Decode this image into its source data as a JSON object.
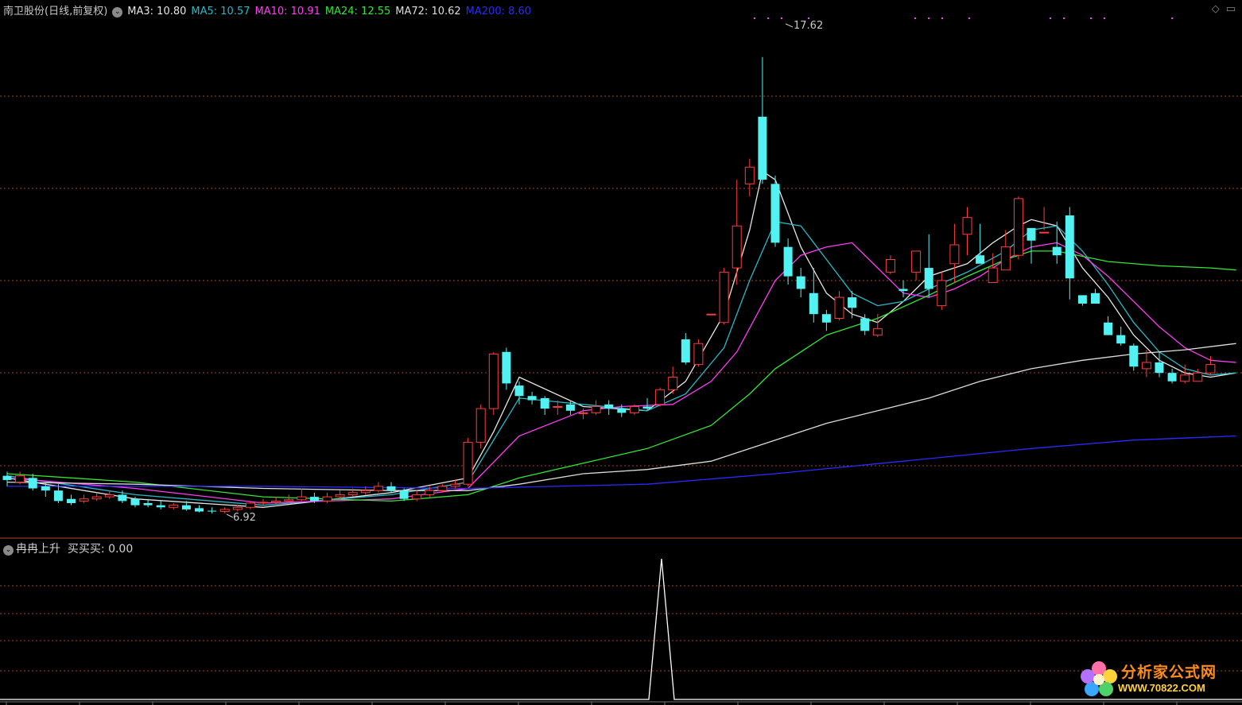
{
  "header": {
    "stock_title": "南卫股份(日线,前复权)",
    "ma_labels": [
      {
        "text": "MA3: 10.80",
        "color": "#e6e6e6"
      },
      {
        "text": "MA5: 10.57",
        "color": "#2ab7c6"
      },
      {
        "text": "MA10: 10.91",
        "color": "#ff3df5"
      },
      {
        "text": "MA24: 12.55",
        "color": "#33e633"
      },
      {
        "text": "MA72: 10.62",
        "color": "#dcdcdc"
      },
      {
        "text": "MA200: 8.60",
        "color": "#2a2aff"
      }
    ]
  },
  "annotations": {
    "high_label": "17.62",
    "low_label": "6.92"
  },
  "indicator": {
    "title": "冉冉上升",
    "value_label": "买买买: 0.00"
  },
  "watermark": {
    "line1": "分析家公式网",
    "line2": "WWW.70822.COM"
  },
  "icons": {
    "toggle": "chevron-circle-icon",
    "diamond": "diamond-icon",
    "minimize": "minimize-icon"
  },
  "colors": {
    "up": "#ff3c3c",
    "down": "#52f2f2",
    "grid": "#a2431c",
    "ma3": "#e6e6e6",
    "ma5": "#2ab7c6",
    "ma10": "#ff3df5",
    "ma24": "#33e633",
    "ma72": "#dcdcdc",
    "ma200": "#2a2aff",
    "indicator": "#ffffff"
  },
  "chart_data": {
    "type": "candlestick",
    "price_range": [
      6.3,
      18.6
    ],
    "high": 17.62,
    "low": 6.92,
    "candles": [
      [
        7.65,
        7.55,
        7.75,
        7.4
      ],
      [
        7.5,
        7.65,
        7.75,
        7.45
      ],
      [
        7.6,
        7.35,
        7.7,
        7.3
      ],
      [
        7.4,
        7.3,
        7.5,
        7.15
      ],
      [
        7.3,
        7.05,
        7.45,
        7.0
      ],
      [
        7.1,
        7.0,
        7.2,
        6.95
      ],
      [
        7.05,
        7.1,
        7.2,
        7.0
      ],
      [
        7.1,
        7.15,
        7.25,
        7.05
      ],
      [
        7.15,
        7.2,
        7.3,
        7.1
      ],
      [
        7.2,
        7.05,
        7.3,
        7.0
      ],
      [
        7.1,
        6.95,
        7.15,
        6.9
      ],
      [
        7.0,
        6.95,
        7.1,
        6.9
      ],
      [
        6.95,
        6.9,
        7.05,
        6.85
      ],
      [
        6.9,
        6.95,
        7.0,
        6.85
      ],
      [
        6.95,
        6.85,
        7.05,
        6.82
      ],
      [
        6.88,
        6.8,
        6.95,
        6.78
      ],
      [
        6.82,
        6.8,
        6.9,
        6.75
      ],
      [
        6.8,
        6.85,
        6.9,
        6.75
      ],
      [
        6.85,
        6.9,
        6.95,
        6.8
      ],
      [
        6.9,
        7.0,
        7.05,
        6.85
      ],
      [
        7.0,
        7.02,
        7.1,
        6.95
      ],
      [
        7.02,
        7.05,
        7.15,
        6.98
      ],
      [
        7.05,
        7.08,
        7.2,
        7.0
      ],
      [
        7.08,
        7.15,
        7.35,
        7.05
      ],
      [
        7.15,
        7.05,
        7.25,
        7.0
      ],
      [
        7.05,
        7.15,
        7.25,
        7.0
      ],
      [
        7.15,
        7.2,
        7.3,
        7.1
      ],
      [
        7.2,
        7.25,
        7.35,
        7.15
      ],
      [
        7.25,
        7.3,
        7.4,
        7.2
      ],
      [
        7.3,
        7.4,
        7.5,
        7.25
      ],
      [
        7.4,
        7.3,
        7.5,
        7.25
      ],
      [
        7.3,
        7.1,
        7.35,
        7.05
      ],
      [
        7.1,
        7.2,
        7.3,
        7.05
      ],
      [
        7.2,
        7.3,
        7.4,
        7.15
      ],
      [
        7.3,
        7.4,
        7.45,
        7.25
      ],
      [
        7.4,
        7.45,
        7.55,
        7.35
      ],
      [
        7.45,
        8.45,
        8.55,
        7.4
      ],
      [
        8.45,
        9.25,
        9.35,
        8.3
      ],
      [
        9.25,
        10.55,
        10.6,
        9.1
      ],
      [
        10.6,
        9.85,
        10.7,
        9.7
      ],
      [
        9.8,
        9.55,
        9.9,
        9.35
      ],
      [
        9.55,
        9.45,
        9.65,
        9.35
      ],
      [
        9.5,
        9.25,
        9.55,
        9.1
      ],
      [
        9.3,
        9.3,
        9.45,
        9.1
      ],
      [
        9.35,
        9.2,
        9.45,
        9.1
      ],
      [
        9.15,
        9.15,
        9.25,
        9.0
      ],
      [
        9.15,
        9.3,
        9.45,
        9.1
      ],
      [
        9.35,
        9.25,
        9.45,
        9.1
      ],
      [
        9.25,
        9.15,
        9.35,
        9.05
      ],
      [
        9.15,
        9.3,
        9.35,
        9.1
      ],
      [
        9.3,
        9.25,
        9.5,
        9.2
      ],
      [
        9.35,
        9.7,
        9.75,
        9.3
      ],
      [
        9.7,
        10.0,
        10.25,
        9.6
      ],
      [
        10.9,
        10.35,
        11.05,
        10.3
      ],
      [
        10.3,
        10.8,
        10.9,
        10.25
      ],
      [
        11.5,
        11.5,
        11.5,
        11.5
      ],
      [
        11.3,
        12.5,
        12.6,
        11.25
      ],
      [
        12.6,
        13.6,
        14.7,
        12.2
      ],
      [
        14.6,
        15.0,
        15.2,
        14.3
      ],
      [
        16.2,
        14.7,
        17.62,
        14.6
      ],
      [
        14.6,
        13.2,
        14.8,
        13.1
      ],
      [
        13.1,
        12.4,
        13.3,
        12.2
      ],
      [
        12.4,
        12.1,
        12.6,
        11.9
      ],
      [
        12.0,
        11.5,
        12.6,
        11.3
      ],
      [
        11.5,
        11.3,
        11.6,
        11.1
      ],
      [
        11.4,
        11.9,
        12.05,
        11.35
      ],
      [
        11.9,
        11.65,
        12.05,
        11.4
      ],
      [
        11.4,
        11.1,
        11.5,
        11.0
      ],
      [
        11.0,
        11.15,
        11.5,
        10.95
      ],
      [
        12.5,
        12.8,
        12.9,
        12.45
      ],
      [
        12.1,
        12.05,
        12.3,
        11.9
      ],
      [
        12.5,
        13.0,
        13.0,
        12.3
      ],
      [
        12.6,
        12.1,
        13.4,
        11.9
      ],
      [
        11.7,
        12.3,
        12.5,
        11.6
      ],
      [
        12.7,
        13.15,
        13.65,
        12.25
      ],
      [
        13.4,
        13.8,
        14.05,
        12.9
      ],
      [
        12.9,
        12.7,
        13.65,
        12.9
      ],
      [
        12.25,
        12.6,
        12.95,
        12.5
      ],
      [
        12.55,
        13.1,
        13.5,
        12.55
      ],
      [
        12.9,
        14.25,
        14.3,
        12.8
      ],
      [
        13.55,
        13.25,
        13.35,
        12.7
      ],
      [
        13.45,
        13.45,
        14.05,
        13.5
      ],
      [
        13.1,
        12.9,
        13.7,
        12.7
      ],
      [
        13.85,
        12.35,
        14.05,
        11.85
      ],
      [
        11.95,
        11.75,
        11.95,
        11.7
      ],
      [
        12.0,
        11.75,
        12.1,
        11.85
      ],
      [
        11.3,
        11.0,
        11.45,
        11.0
      ],
      [
        11.0,
        10.8,
        11.2,
        10.75
      ],
      [
        10.75,
        10.25,
        10.8,
        10.15
      ],
      [
        10.2,
        10.35,
        10.65,
        10.0
      ],
      [
        10.35,
        10.1,
        10.6,
        10.0
      ],
      [
        10.1,
        9.9,
        10.2,
        9.85
      ],
      [
        9.9,
        10.05,
        10.3,
        9.85
      ],
      [
        9.9,
        10.1,
        10.2,
        9.9
      ],
      [
        10.1,
        10.3,
        10.5,
        10.05
      ]
    ],
    "ma": {
      "MA3": [
        [
          0,
          7.6
        ],
        [
          10,
          7.1
        ],
        [
          20,
          6.9
        ],
        [
          30,
          7.25
        ],
        [
          36,
          7.6
        ],
        [
          38,
          8.7
        ],
        [
          40,
          10.0
        ],
        [
          45,
          9.3
        ],
        [
          50,
          9.2
        ],
        [
          53,
          9.9
        ],
        [
          56,
          11.5
        ],
        [
          58,
          13.5
        ],
        [
          59,
          14.9
        ],
        [
          60,
          14.7
        ],
        [
          62,
          13.1
        ],
        [
          64,
          12.0
        ],
        [
          66,
          11.5
        ],
        [
          68,
          11.3
        ],
        [
          70,
          11.8
        ],
        [
          72,
          12.4
        ],
        [
          75,
          12.7
        ],
        [
          77,
          13.2
        ],
        [
          79,
          13.6
        ],
        [
          80,
          13.75
        ],
        [
          82,
          13.6
        ],
        [
          84,
          12.6
        ],
        [
          86,
          11.9
        ],
        [
          88,
          11.0
        ],
        [
          90,
          10.4
        ],
        [
          92,
          10.1
        ],
        [
          94,
          10.0
        ],
        [
          96,
          10.1
        ]
      ],
      "MA5": [
        [
          0,
          7.65
        ],
        [
          10,
          7.2
        ],
        [
          20,
          6.95
        ],
        [
          30,
          7.2
        ],
        [
          36,
          7.5
        ],
        [
          40,
          9.5
        ],
        [
          45,
          9.35
        ],
        [
          50,
          9.2
        ],
        [
          53,
          9.6
        ],
        [
          56,
          10.7
        ],
        [
          58,
          12.3
        ],
        [
          60,
          13.7
        ],
        [
          62,
          13.6
        ],
        [
          64,
          12.8
        ],
        [
          66,
          12.0
        ],
        [
          68,
          11.7
        ],
        [
          70,
          11.8
        ],
        [
          72,
          12.1
        ],
        [
          75,
          12.5
        ],
        [
          78,
          13.0
        ],
        [
          80,
          13.5
        ],
        [
          82,
          13.6
        ],
        [
          84,
          13.0
        ],
        [
          86,
          12.2
        ],
        [
          88,
          11.3
        ],
        [
          90,
          10.6
        ],
        [
          92,
          10.2
        ],
        [
          94,
          10.05
        ],
        [
          96,
          10.1
        ]
      ],
      "MA10": [
        [
          0,
          7.6
        ],
        [
          10,
          7.35
        ],
        [
          20,
          7.0
        ],
        [
          30,
          7.1
        ],
        [
          36,
          7.35
        ],
        [
          40,
          8.6
        ],
        [
          45,
          9.2
        ],
        [
          48,
          9.3
        ],
        [
          52,
          9.35
        ],
        [
          55,
          9.9
        ],
        [
          57,
          10.6
        ],
        [
          60,
          12.3
        ],
        [
          62,
          12.9
        ],
        [
          64,
          13.1
        ],
        [
          66,
          13.2
        ],
        [
          68,
          12.6
        ],
        [
          70,
          12.0
        ],
        [
          72,
          11.9
        ],
        [
          74,
          12.1
        ],
        [
          76,
          12.4
        ],
        [
          78,
          12.8
        ],
        [
          80,
          13.1
        ],
        [
          82,
          13.2
        ],
        [
          84,
          12.9
        ],
        [
          86,
          12.4
        ],
        [
          88,
          11.8
        ],
        [
          90,
          11.2
        ],
        [
          92,
          10.7
        ],
        [
          94,
          10.4
        ],
        [
          96,
          10.35
        ]
      ],
      "MA24": [
        [
          0,
          7.7
        ],
        [
          10,
          7.5
        ],
        [
          20,
          7.15
        ],
        [
          30,
          7.05
        ],
        [
          36,
          7.2
        ],
        [
          40,
          7.6
        ],
        [
          45,
          7.95
        ],
        [
          50,
          8.3
        ],
        [
          55,
          8.85
        ],
        [
          58,
          9.6
        ],
        [
          60,
          10.2
        ],
        [
          64,
          11.0
        ],
        [
          68,
          11.4
        ],
        [
          72,
          11.95
        ],
        [
          75,
          12.4
        ],
        [
          78,
          12.8
        ],
        [
          80,
          13.0
        ],
        [
          82,
          13.0
        ],
        [
          86,
          12.75
        ],
        [
          90,
          12.65
        ],
        [
          94,
          12.6
        ],
        [
          96,
          12.55
        ]
      ],
      "MA72": [
        [
          0,
          7.5
        ],
        [
          10,
          7.45
        ],
        [
          20,
          7.35
        ],
        [
          30,
          7.3
        ],
        [
          36,
          7.3
        ],
        [
          40,
          7.45
        ],
        [
          45,
          7.7
        ],
        [
          50,
          7.8
        ],
        [
          55,
          8.0
        ],
        [
          60,
          8.5
        ],
        [
          64,
          8.9
        ],
        [
          68,
          9.2
        ],
        [
          72,
          9.5
        ],
        [
          76,
          9.9
        ],
        [
          80,
          10.2
        ],
        [
          84,
          10.4
        ],
        [
          88,
          10.55
        ],
        [
          92,
          10.65
        ],
        [
          96,
          10.8
        ]
      ],
      "MA200": [
        [
          0,
          7.4
        ],
        [
          20,
          7.4
        ],
        [
          36,
          7.35
        ],
        [
          40,
          7.38
        ],
        [
          50,
          7.45
        ],
        [
          60,
          7.7
        ],
        [
          70,
          8.0
        ],
        [
          80,
          8.3
        ],
        [
          88,
          8.5
        ],
        [
          96,
          8.6
        ]
      ]
    },
    "indicator_series": {
      "name": "买买买",
      "spike_index": 53,
      "spike_value": 1,
      "base_value": 0
    }
  }
}
